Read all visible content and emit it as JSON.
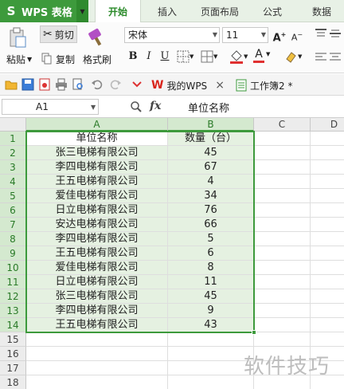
{
  "app": {
    "name": "WPS 表格",
    "logo_letter": "S",
    "accent": "#3d9a3c"
  },
  "ribbon_tabs": [
    {
      "label": "开始",
      "active": true
    },
    {
      "label": "插入",
      "active": false
    },
    {
      "label": "页面布局",
      "active": false
    },
    {
      "label": "公式",
      "active": false
    },
    {
      "label": "数据",
      "active": false
    }
  ],
  "ribbon": {
    "cut_label": "剪切",
    "paste_label": "粘贴",
    "copy_label": "复制",
    "format_painter_label": "格式刷",
    "font_name": "宋体",
    "font_size": "11",
    "bold": "B",
    "italic": "I",
    "underline": "U",
    "font_color_letter": "A",
    "grow_font": "A",
    "shrink_font": "A"
  },
  "quick_access": {
    "doc_tabs": [
      {
        "label": "我的WPS",
        "close": "×"
      },
      {
        "label": "工作簿2 *"
      }
    ]
  },
  "formula_bar": {
    "cell_ref": "A1",
    "fx": "fx",
    "content": "单位名称"
  },
  "sheet": {
    "columns": [
      "A",
      "B",
      "C",
      "D"
    ],
    "rows": [
      "1",
      "2",
      "3",
      "4",
      "5",
      "6",
      "7",
      "8",
      "9",
      "10",
      "11",
      "12",
      "13",
      "14",
      "15",
      "16",
      "17",
      "18"
    ],
    "header_row": [
      "单位名称",
      "数量（台）"
    ],
    "data": [
      [
        "张三电梯有限公司",
        "45"
      ],
      [
        "李四电梯有限公司",
        "67"
      ],
      [
        "王五电梯有限公司",
        "4"
      ],
      [
        "爱佳电梯有限公司",
        "34"
      ],
      [
        "日立电梯有限公司",
        "76"
      ],
      [
        "安达电梯有限公司",
        "66"
      ],
      [
        "李四电梯有限公司",
        "5"
      ],
      [
        "王五电梯有限公司",
        "6"
      ],
      [
        "爱佳电梯有限公司",
        "8"
      ],
      [
        "日立电梯有限公司",
        "11"
      ],
      [
        "张三电梯有限公司",
        "45"
      ],
      [
        "李四电梯有限公司",
        "9"
      ],
      [
        "王五电梯有限公司",
        "43"
      ]
    ]
  },
  "watermark": "软件技巧"
}
